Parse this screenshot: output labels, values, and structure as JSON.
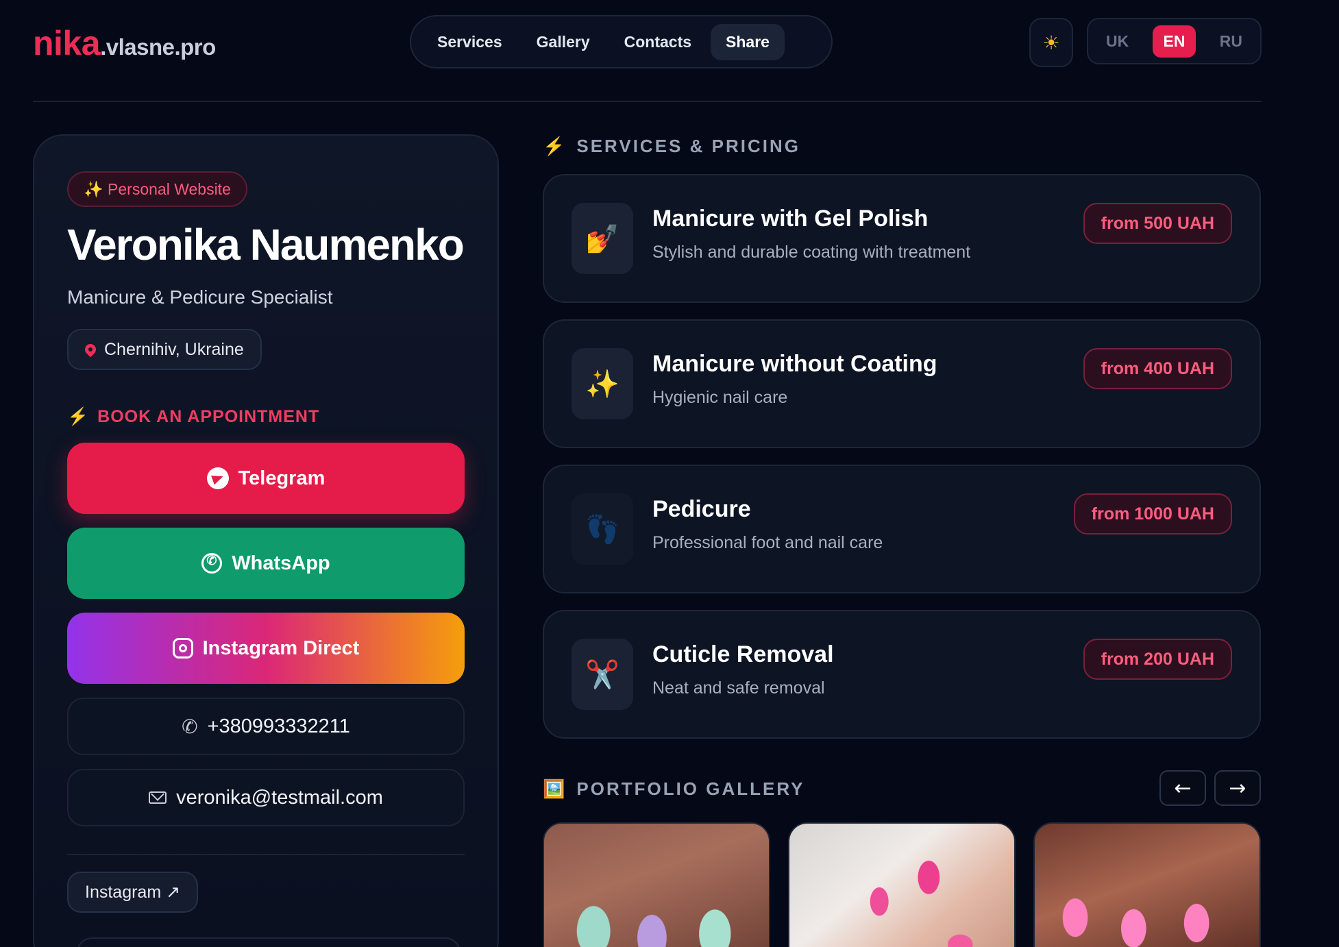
{
  "header": {
    "logo_brand": "nika",
    "logo_domain": ".vlasne.pro",
    "nav": [
      "Services",
      "Gallery",
      "Contacts",
      "Share"
    ],
    "nav_active": "Share",
    "theme_icon": "sun-icon",
    "languages": [
      "UK",
      "EN",
      "RU"
    ],
    "language_active": "EN"
  },
  "profile": {
    "badge": "✨ Personal Website",
    "name": "Veronika Naumenko",
    "role": "Manicure & Pedicure Specialist",
    "location": "Chernihiv, Ukraine",
    "book_label": "BOOK AN APPOINTMENT",
    "buttons": {
      "telegram": "Telegram",
      "whatsapp": "WhatsApp",
      "instagram": "Instagram Direct",
      "phone": "+380993332211",
      "email": "veronika@testmail.com"
    },
    "social_link": "Instagram ↗"
  },
  "services": {
    "title": "SERVICES & PRICING",
    "items": [
      {
        "icon": "💅",
        "name": "Manicure with Gel Polish",
        "desc": "Stylish and durable coating with treatment",
        "price": "from 500 UAH"
      },
      {
        "icon": "✨",
        "name": "Manicure without Coating",
        "desc": "Hygienic nail care",
        "price": "from 400 UAH"
      },
      {
        "icon": "👣",
        "name": "Pedicure",
        "desc": "Professional foot and nail care",
        "price": "from 1000 UAH"
      },
      {
        "icon": "✂️",
        "name": "Cuticle Removal",
        "desc": "Neat and safe removal",
        "price": "from 200 UAH"
      }
    ]
  },
  "gallery": {
    "title": "PORTFOLIO GALLERY",
    "icon": "🖼️",
    "prev_label": "←",
    "next_label": "→"
  },
  "colors": {
    "accent": "#e51c4a",
    "whatsapp": "#0f9b6c",
    "background": "#040817"
  }
}
